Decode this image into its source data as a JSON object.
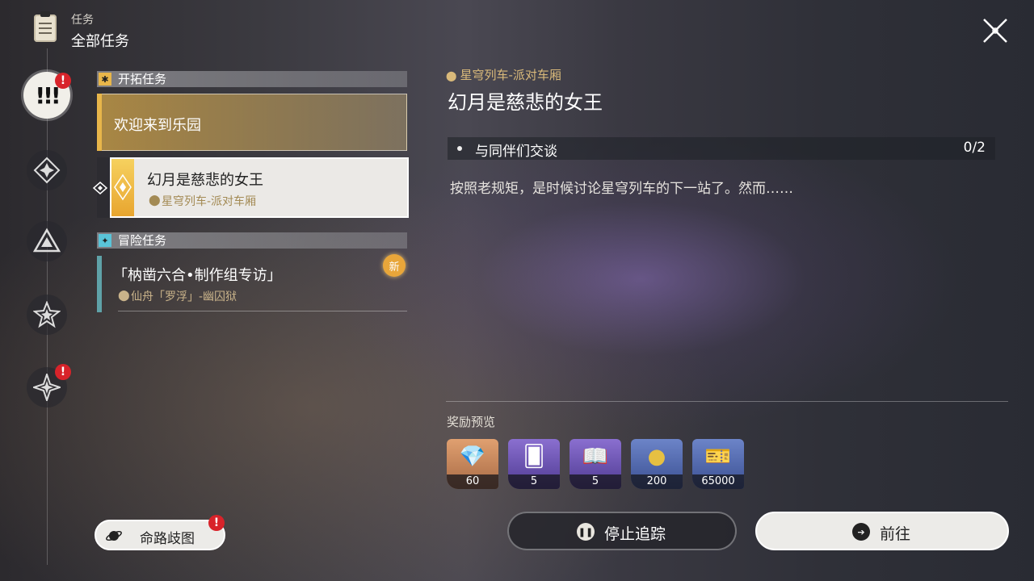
{
  "header": {
    "subtitle": "任务",
    "title": "全部任务"
  },
  "rail": [
    {
      "name": "rail-all-quests",
      "icon": "exclamation-icon",
      "active": true,
      "badge": "!"
    },
    {
      "name": "rail-trailblaze",
      "icon": "diamond-star-icon",
      "active": false
    },
    {
      "name": "rail-companion",
      "icon": "triangle-icon",
      "active": false
    },
    {
      "name": "rail-adventure",
      "icon": "star-icon",
      "active": false
    },
    {
      "name": "rail-daily",
      "icon": "four-point-star-icon",
      "active": false,
      "badge": "!"
    }
  ],
  "sections": {
    "trailblaze": {
      "label": "开拓任务",
      "items": [
        {
          "title": "欢迎来到乐园"
        },
        {
          "title": "幻月是慈悲的女王",
          "location": "星穹列车-派对车厢"
        }
      ]
    },
    "adventure": {
      "label": "冒险任务",
      "items": [
        {
          "title": "「枘凿六合•制作组专访」",
          "location": "仙舟「罗浮」-幽囚狱",
          "badge": "新"
        }
      ]
    }
  },
  "detail": {
    "location": "星穹列车-派对车厢",
    "title": "幻月是慈悲的女王",
    "objective": {
      "text": "与同伴们交谈",
      "progress": "0/2"
    },
    "description": "按照老规矩，是时候讨论星穹列车的下一站了。然而……",
    "rewards_header": "奖励预览",
    "rewards": [
      {
        "icon": "crystal-icon",
        "count": "60",
        "color": "#c97f4a"
      },
      {
        "icon": "card-icon",
        "count": "5",
        "color": "#6a4fb0"
      },
      {
        "icon": "book-icon",
        "count": "5",
        "color": "#6a4fb0"
      },
      {
        "icon": "coin-icon",
        "count": "200",
        "color": "#4d63a8"
      },
      {
        "icon": "ticket-icon",
        "count": "65000",
        "color": "#4d63a8"
      }
    ]
  },
  "buttons": {
    "stop_tracking": "停止追踪",
    "go": "前往",
    "path": "命路歧图",
    "path_badge": "!"
  },
  "colors": {
    "accent_gold": "#e8b64a",
    "adventure_teal": "#5fa2a8",
    "alert_red": "#d8232a"
  }
}
